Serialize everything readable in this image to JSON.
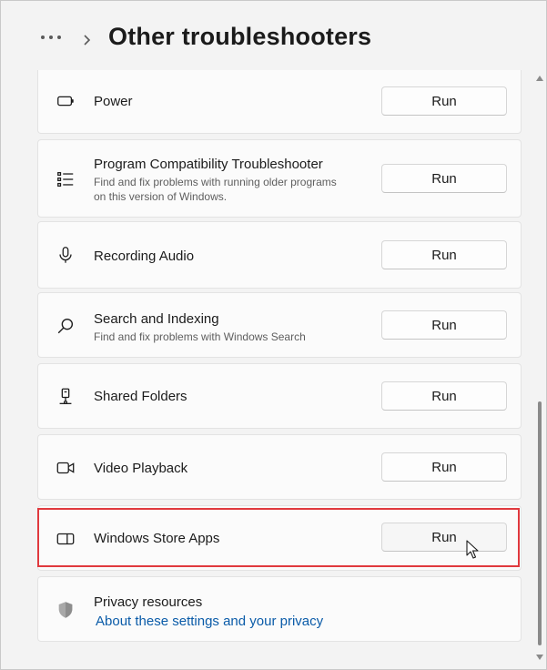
{
  "header": {
    "more_icon": "ellipsis-icon",
    "chevron_icon": "chevron-right-icon",
    "title": "Other troubleshooters"
  },
  "items": [
    {
      "icon": "battery-icon",
      "title": "Power",
      "run": "Run"
    },
    {
      "icon": "list-icon",
      "title": "Program Compatibility Troubleshooter",
      "description": "Find and fix problems with running older programs on this version of Windows.",
      "run": "Run"
    },
    {
      "icon": "microphone-icon",
      "title": "Recording Audio",
      "run": "Run"
    },
    {
      "icon": "search-icon",
      "title": "Search and Indexing",
      "description": "Find and fix problems with Windows Search",
      "run": "Run"
    },
    {
      "icon": "shared-folder-icon",
      "title": "Shared Folders",
      "run": "Run"
    },
    {
      "icon": "video-camera-icon",
      "title": "Video Playback",
      "run": "Run"
    },
    {
      "icon": "store-apps-icon",
      "title": "Windows Store Apps",
      "run": "Run",
      "highlighted": true
    }
  ],
  "privacy": {
    "icon": "shield-icon",
    "title": "Privacy resources",
    "link": "About these settings and your privacy"
  },
  "colors": {
    "highlight_border": "#e0393e",
    "link": "#0a5ba8",
    "background": "#f3f3f3",
    "card": "#fbfbfb"
  }
}
